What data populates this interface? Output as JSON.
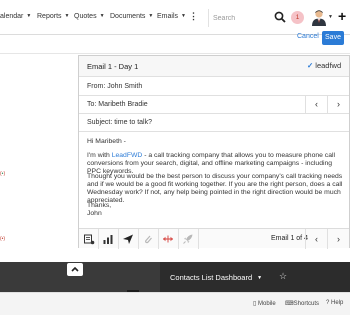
{
  "nav": {
    "items": [
      "alendar",
      "Reports",
      "Quotes",
      "Documents",
      "Emails"
    ],
    "search_placeholder": "Search",
    "notification_count": "1"
  },
  "actions": {
    "cancel": "Cancel",
    "save": "Save"
  },
  "email": {
    "title": "Email 1 - Day 1",
    "logo_text": "leadfwd",
    "from": "From: John Smith",
    "to": "To: Maribeth Bradie",
    "subject": "Subject: time to talk?",
    "greeting": "Hi Maribeth -",
    "para1_pre": "I'm with ",
    "para1_link": "LeadFWD",
    "para1_post": " - a call tracking company that allows you to measure phone call conversions from your search, digital, and offline marketing campaigns - including PPC keywords.",
    "para2": "Thought you would be the best person to discuss your company's call tracking needs and if we would be a good fit working together. If you are the right person, does a call Wednesday work? If not, any help being pointed in the right direction would be much appreciated.",
    "closing": "Thanks,",
    "signature": "John",
    "counter": "Email 1 of 4"
  },
  "dashboard": {
    "title": "Contacts List Dashboard"
  },
  "footer": {
    "mobile": "Mobile",
    "shortcuts": "Shortcuts",
    "help": "Help"
  },
  "colors": {
    "accent": "#2b7bd6",
    "notif_bg": "#f5c2c7"
  }
}
